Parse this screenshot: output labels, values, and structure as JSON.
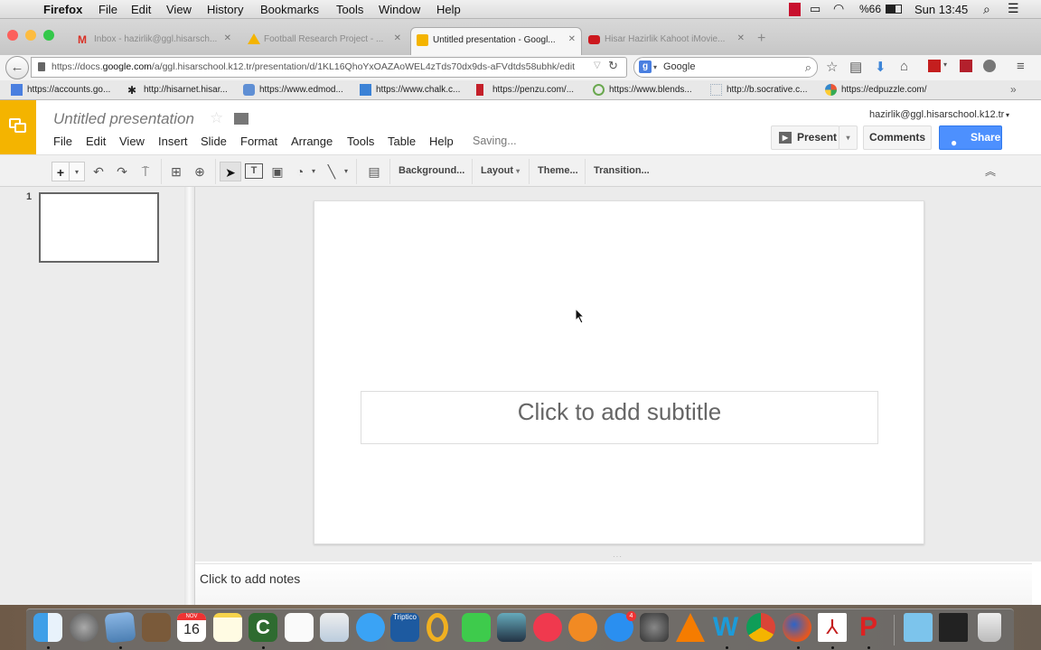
{
  "menubar": {
    "app_name": "Firefox",
    "items": [
      "File",
      "Edit",
      "View",
      "History",
      "Bookmarks",
      "Tools",
      "Window",
      "Help"
    ],
    "battery": "%66",
    "clock": "Sun 13:45"
  },
  "browser": {
    "tabs": [
      {
        "title": "Inbox - hazirlik@ggl.hisarsch...",
        "icon": "gmail-icon",
        "active": false
      },
      {
        "title": "Football Research Project - ...",
        "icon": "google-drive-icon",
        "active": false
      },
      {
        "title": "Untitled presentation - Googl...",
        "icon": "google-slides-icon",
        "active": true
      },
      {
        "title": "Hisar Hazirlik Kahoot iMovie...",
        "icon": "youtube-icon",
        "active": false
      }
    ],
    "new_tab": "+",
    "url_prefix": "https://docs.",
    "url_domain": "google.com",
    "url_suffix": "/a/ggl.hisarschool.k12.tr/presentation/d/1KL16QhoYxOAZAoWEL4zTds70dx9ds-aFVdtds58ubhk/edit",
    "search_engine": "Google",
    "search_placeholder": "Google",
    "bookmarks": [
      "https://accounts.go...",
      "http://hisarnet.hisar...",
      "https://www.edmod...",
      "https://www.chalk.c...",
      "https://penzu.com/...",
      "https://www.blends...",
      "http://b.socrative.c...",
      "https://edpuzzle.com/"
    ],
    "bookmarks_overflow": "»"
  },
  "slides": {
    "doc_title": "Untitled presentation",
    "menu": [
      "File",
      "Edit",
      "View",
      "Insert",
      "Slide",
      "Format",
      "Arrange",
      "Tools",
      "Table",
      "Help"
    ],
    "save_status": "Saving...",
    "account": "hazirlik@ggl.hisarschool.k12.tr",
    "present_label": "Present",
    "comments_label": "Comments",
    "share_label": "Share",
    "toolbar": {
      "background": "Background...",
      "layout": "Layout",
      "theme": "Theme...",
      "transition": "Transition..."
    },
    "slide_number": "1",
    "subtitle_placeholder": "Click to add subtitle",
    "notes_placeholder": "Click to add notes",
    "colors": {
      "brand": "#f4b400",
      "share": "#4d90fe"
    }
  },
  "dock": {
    "calendar_month": "NOV",
    "calendar_day": "16",
    "triptico_label": "Triptico",
    "appstore_badge": "4"
  }
}
